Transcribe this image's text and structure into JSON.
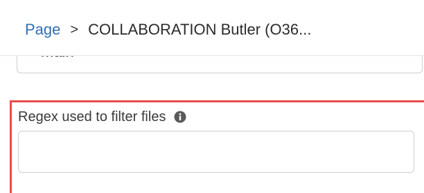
{
  "breadcrumb": {
    "root_label": "Page",
    "separator": ">",
    "current_label": "COLLABORATION Butler (O36..."
  },
  "previous_field": {
    "value": "main"
  },
  "regex_field": {
    "label": "Regex used to filter files",
    "info_icon": "info-circle-icon",
    "value": "",
    "placeholder": ""
  },
  "colors": {
    "link": "#2f6fb3",
    "highlight_border": "#e94b4b",
    "field_border": "#cfcfcf"
  }
}
